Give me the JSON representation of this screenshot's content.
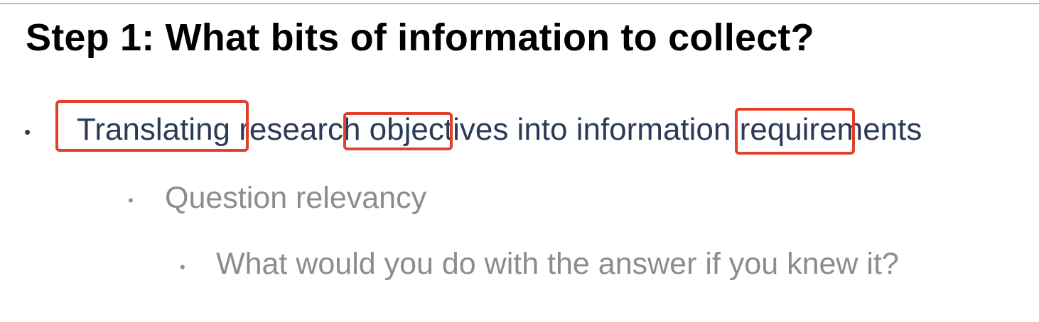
{
  "slide": {
    "title": "Step 1: What bits of information to collect?",
    "bullets": [
      {
        "level": 1,
        "marker": "•",
        "text": "Translating research objectives into information requirements"
      },
      {
        "level": 2,
        "marker": "•",
        "text": "Question relevancy"
      },
      {
        "level": 3,
        "marker": "•",
        "text": "What would you do with the answer if you knew it?"
      }
    ]
  },
  "colors": {
    "title": "#000000",
    "level1_text": "#2b3a57",
    "sub_text": "#8c8c8c",
    "highlight_border": "#e3402b",
    "top_rule": "#c9b7c4"
  }
}
